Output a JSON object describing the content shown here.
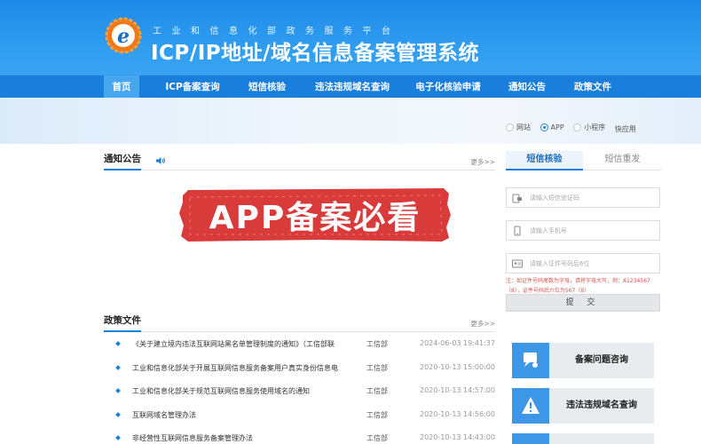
{
  "header": {
    "subtitle": "工业和信息化部政务服务平台",
    "title": "ICP/IP地址/域名信息备案管理系统"
  },
  "nav": {
    "items": [
      "首页",
      "ICP备案查询",
      "短信核验",
      "违法违规域名查询",
      "电子化核验申请",
      "通知公告",
      "政策文件"
    ],
    "active_index": 0
  },
  "app_type": {
    "options": [
      "网站",
      "APP",
      "小程序",
      "快应用"
    ],
    "selected": "APP"
  },
  "notice": {
    "title": "通知公告",
    "more": "更多>>",
    "stamp_text": "APP备案必看"
  },
  "policy": {
    "title": "政策文件",
    "more": "更多>>",
    "rows": [
      {
        "title": "《关于建立境内违法互联网站黑名单管理制度的通知》（工信部联",
        "dept": "工信部",
        "date": "2024-06-03 19:41:37"
      },
      {
        "title": "工业和信息化部关于开展互联网信息服务备案用户真实身份信息电",
        "dept": "工信部",
        "date": "2020-10-13 15:00:00"
      },
      {
        "title": "工业和信息化部关于规范互联网信息服务使用域名的通知",
        "dept": "工信部",
        "date": "2020-10-13 14:57:00"
      },
      {
        "title": "互联网域名管理办法",
        "dept": "工信部",
        "date": "2020-10-13 14:56:00"
      },
      {
        "title": "非经营性互联网信息服务备案管理办法",
        "dept": "工信部",
        "date": "2020-10-13 14:43:00"
      }
    ]
  },
  "sms": {
    "tab_active": "短信核验",
    "tab_inactive": "短信重发",
    "code_placeholder": "请输入短信验证码",
    "phone_placeholder": "请输入手机号",
    "id_placeholder": "请输入证件号码后6位",
    "hint_line1": "注：如证件号码尾数为字母，请将字母大写，例：A1234567",
    "hint_line2": "（8），证件号码后六位为567（8）",
    "submit_label": "提 交"
  },
  "quick_links": [
    {
      "label": "备案问题咨询",
      "icon": "consult-icon"
    },
    {
      "label": "违法违规域名查询",
      "icon": "warning-icon"
    }
  ],
  "colors": {
    "header_blue": "#2f9cf0",
    "nav_blue": "#1a7fdc",
    "stamp_red": "#d93a3a"
  }
}
